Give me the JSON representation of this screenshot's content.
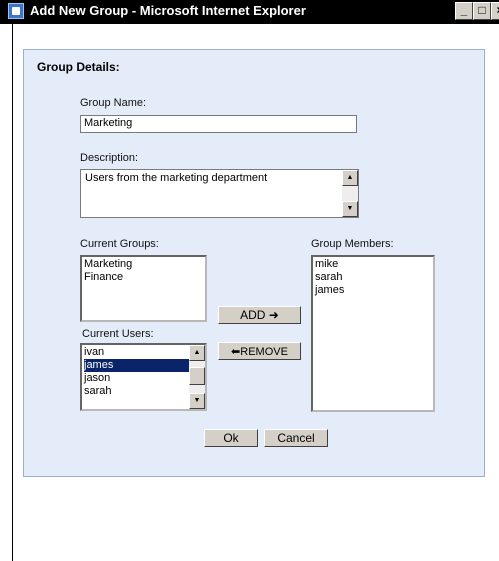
{
  "window": {
    "title": "Add New Group - Microsoft Internet Explorer",
    "icon": "ie-page-icon",
    "controls": [
      "minimize-icon",
      "maximize-icon",
      "close-icon"
    ]
  },
  "form": {
    "heading": "Group Details:",
    "group_name_label": "Group Name:",
    "group_name_value": "Marketing",
    "description_label": "Description:",
    "description_value": "Users from the marketing department",
    "current_groups_label": "Current Groups:",
    "current_groups": [
      "Marketing",
      "Finance"
    ],
    "group_members_label": "Group Members:",
    "group_members": [
      "mike",
      "sarah",
      "james"
    ],
    "current_users_label": "Current Users:",
    "current_users": [
      "ivan",
      "james",
      "jason",
      "sarah"
    ],
    "current_users_selected": "james",
    "add_label": "ADD ➜",
    "remove_label": "⬅REMOVE",
    "ok_label": "Ok",
    "cancel_label": "Cancel"
  },
  "colors": {
    "panel_bg": "#e3ecf8",
    "selection": "#0a246a",
    "titlebar": "#000000"
  }
}
